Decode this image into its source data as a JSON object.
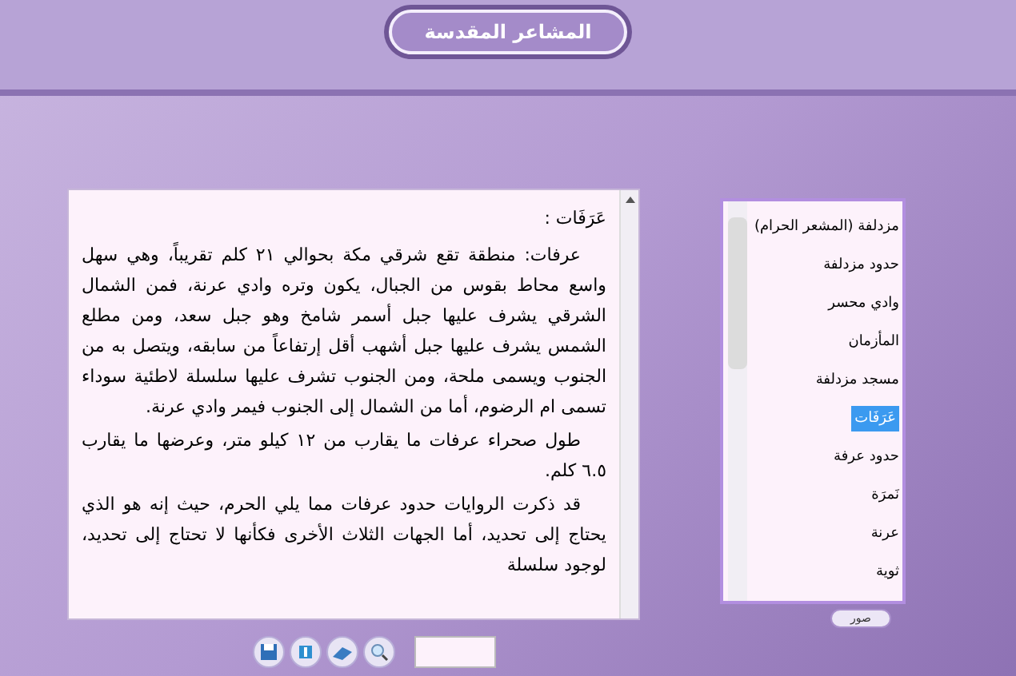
{
  "header": {
    "title": "المشاعر المقدسة"
  },
  "article": {
    "heading": "عَرَفَات :",
    "paragraphs": [
      "عرفات: منطقة تقع شرقي مكة بحوالي ٢١ كلم تقريباً، وهي سهل واسع محاط بقوس من الجبال، يكون وتره وادي عرنة، فمن الشمال الشرقي يشرف عليها جبل أسمر شامخ وهو جبل سعد، ومن مطلع الشمس يشرف عليها جبل أشهب أقل إرتفاعاً من سابقه، ويتصل به من الجنوب ويسمى ملحة، ومن الجنوب تشرف عليها سلسلة لاطئية سوداء تسمى ام الرضوم، أما من الشمال إلى الجنوب فيمر وادي عرنة.",
      "طول صحراء عرفات ما يقارب من ١٢ كيلو متر، وعرضها ما يقارب ٦.٥ كلم.",
      "قد ذكرت الروايات حدود عرفات مما يلي الحرم، حيث إنه هو الذي يحتاج إلى تحديد، أما الجهات الثلاث الأخرى فكأنها لا تحتاج إلى تحديد، لوجود سلسلة"
    ]
  },
  "places": [
    {
      "label": "مزدلفة (المشعر الحرام)",
      "selected": false
    },
    {
      "label": "حدود مزدلفة",
      "selected": false
    },
    {
      "label": "وادي محسر",
      "selected": false
    },
    {
      "label": "المأزمان",
      "selected": false
    },
    {
      "label": "مسجد مزدلفة",
      "selected": false
    },
    {
      "label": "عَرَفَات",
      "selected": true
    },
    {
      "label": "حدود عرفة",
      "selected": false
    },
    {
      "label": "نَمرَة",
      "selected": false
    },
    {
      "label": "عرنة",
      "selected": false
    },
    {
      "label": "ثوية",
      "selected": false
    }
  ],
  "photos_button": "صور"
}
